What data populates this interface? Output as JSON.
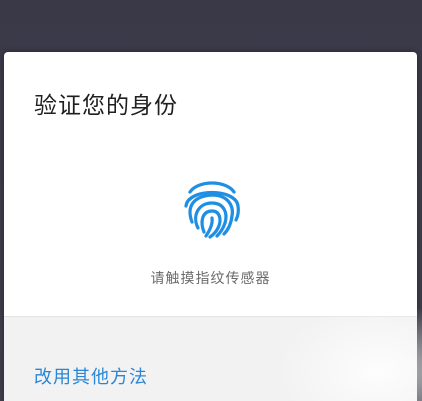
{
  "dialog": {
    "title": "验证您的身份",
    "prompt": "请触摸指纹传感器",
    "alt_method_label": "改用其他方法"
  },
  "colors": {
    "backdrop": "#3c3b4a",
    "dialog_bg": "#ffffff",
    "footer_bg": "#f2f2f2",
    "accent": "#2a86d6",
    "fingerprint": "#1e8fe3"
  },
  "icons": {
    "fingerprint": "fingerprint-icon"
  }
}
